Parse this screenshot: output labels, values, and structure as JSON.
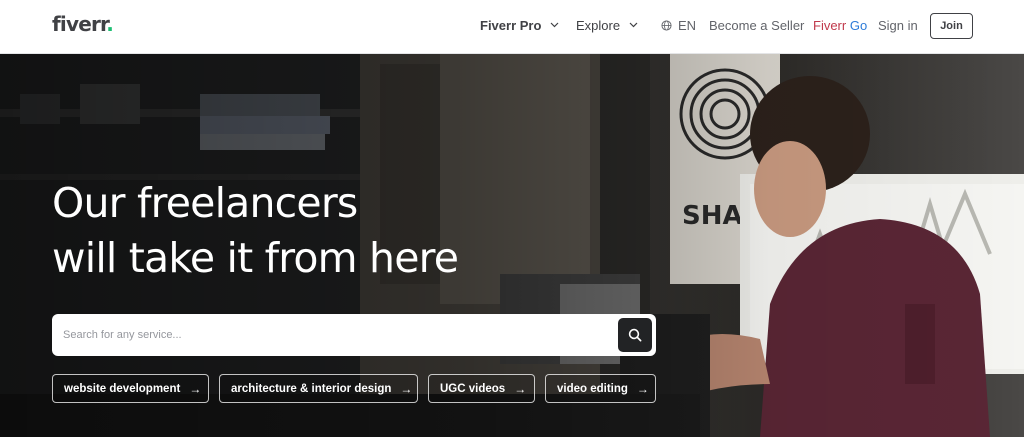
{
  "header": {
    "logo_text": "fiverr",
    "logo_dot": ".",
    "nav": {
      "pro": "Fiverr Pro",
      "explore": "Explore",
      "language": "EN",
      "become_seller": "Become a Seller",
      "go_prefix": "Fiverr",
      "go_suffix": "Go",
      "sign_in": "Sign in",
      "join": "Join"
    }
  },
  "hero": {
    "headline_line1": "Our freelancers",
    "headline_line2": "will take it from here",
    "search": {
      "placeholder": "Search for any service...",
      "value": ""
    },
    "chips": [
      {
        "label": "website development",
        "arrow": "→"
      },
      {
        "label": "architecture & interior design",
        "arrow": "→"
      },
      {
        "label": "UGC videos",
        "arrow": "→"
      },
      {
        "label": "video editing",
        "arrow": "→"
      }
    ]
  },
  "icons": {
    "chevron": "chevron-down-icon",
    "globe": "globe-icon",
    "search": "search-icon",
    "arrow": "arrow-right-icon"
  },
  "colors": {
    "brand_green": "#1dbf73",
    "text_dark": "#404145",
    "go_blue": "#2d7bd8",
    "search_button": "#222325"
  }
}
